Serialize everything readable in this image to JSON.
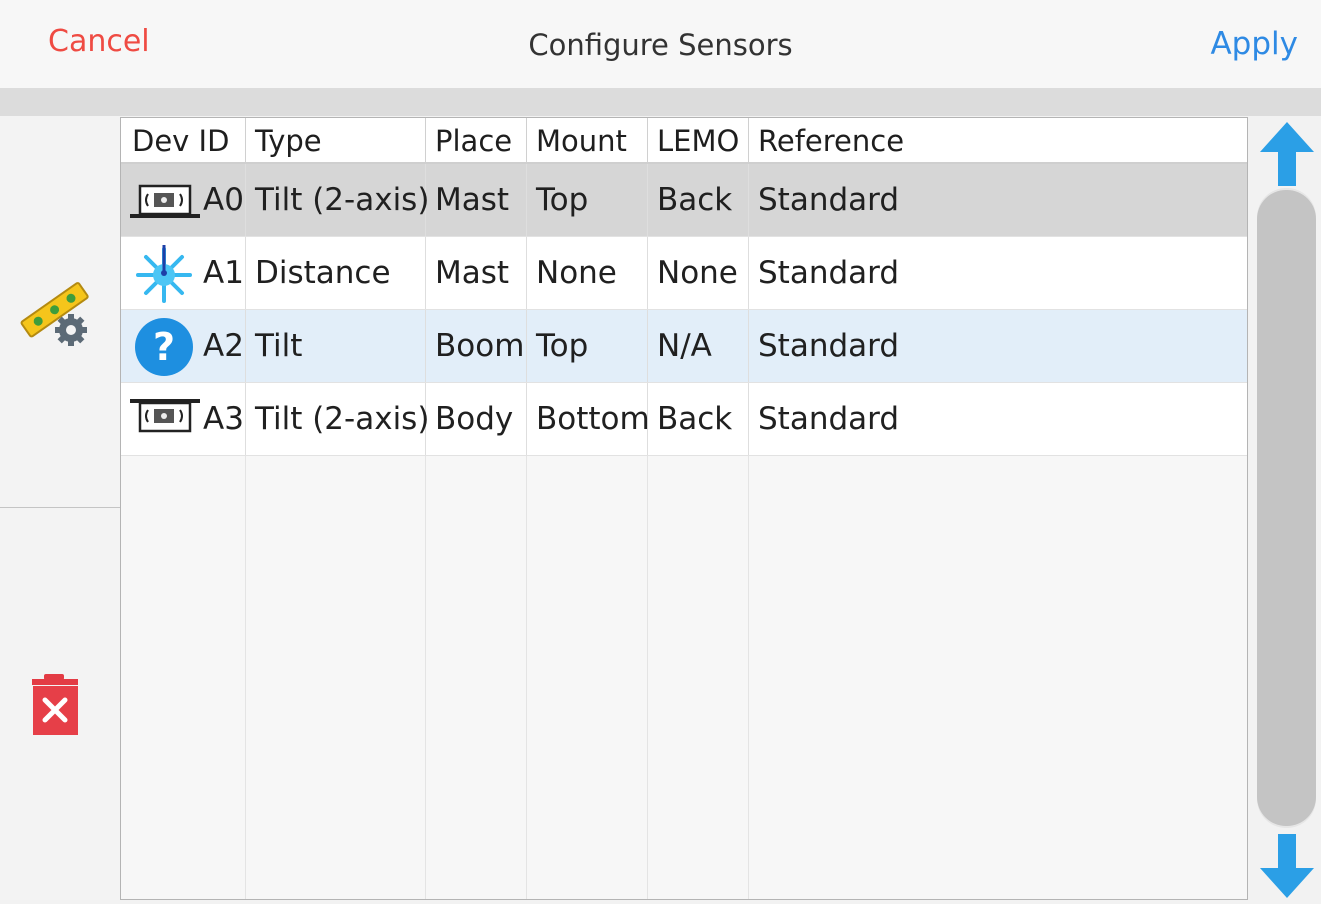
{
  "header": {
    "cancel_label": "Cancel",
    "title": "Configure Sensors",
    "apply_label": "Apply",
    "colors": {
      "cancel": "#ef4b43",
      "apply": "#2e8ae4"
    }
  },
  "sidebar": {
    "config_icon": "level-gear-icon",
    "delete_icon": "trash-delete-icon"
  },
  "table": {
    "columns": [
      "Dev ID",
      "Type",
      "Place",
      "Mount",
      "LEMO",
      "Reference"
    ],
    "rows": [
      {
        "icon": "tilt-2axis-sensor-icon",
        "id": "A0",
        "type": "Tilt (2-axis)",
        "place": "Mast",
        "mount": "Top",
        "lemo": "Back",
        "reference": "Standard",
        "state": "selected"
      },
      {
        "icon": "distance-laser-icon",
        "id": "A1",
        "type": "Distance",
        "place": "Mast",
        "mount": "None",
        "lemo": "None",
        "reference": "Standard",
        "state": "normal"
      },
      {
        "icon": "help-question-icon",
        "id": "A2",
        "type": "Tilt",
        "place": "Boom",
        "mount": "Top",
        "lemo": "N/A",
        "reference": "Standard",
        "state": "highlighted"
      },
      {
        "icon": "tilt-2axis-inverted-sensor-icon",
        "id": "A3",
        "type": "Tilt (2-axis)",
        "place": "Body",
        "mount": "Bottom",
        "lemo": "Back",
        "reference": "Standard",
        "state": "normal"
      }
    ]
  },
  "scrollbar": {
    "up_icon": "arrow-up-icon",
    "down_icon": "arrow-down-icon",
    "accent": "#2b9fe6"
  }
}
